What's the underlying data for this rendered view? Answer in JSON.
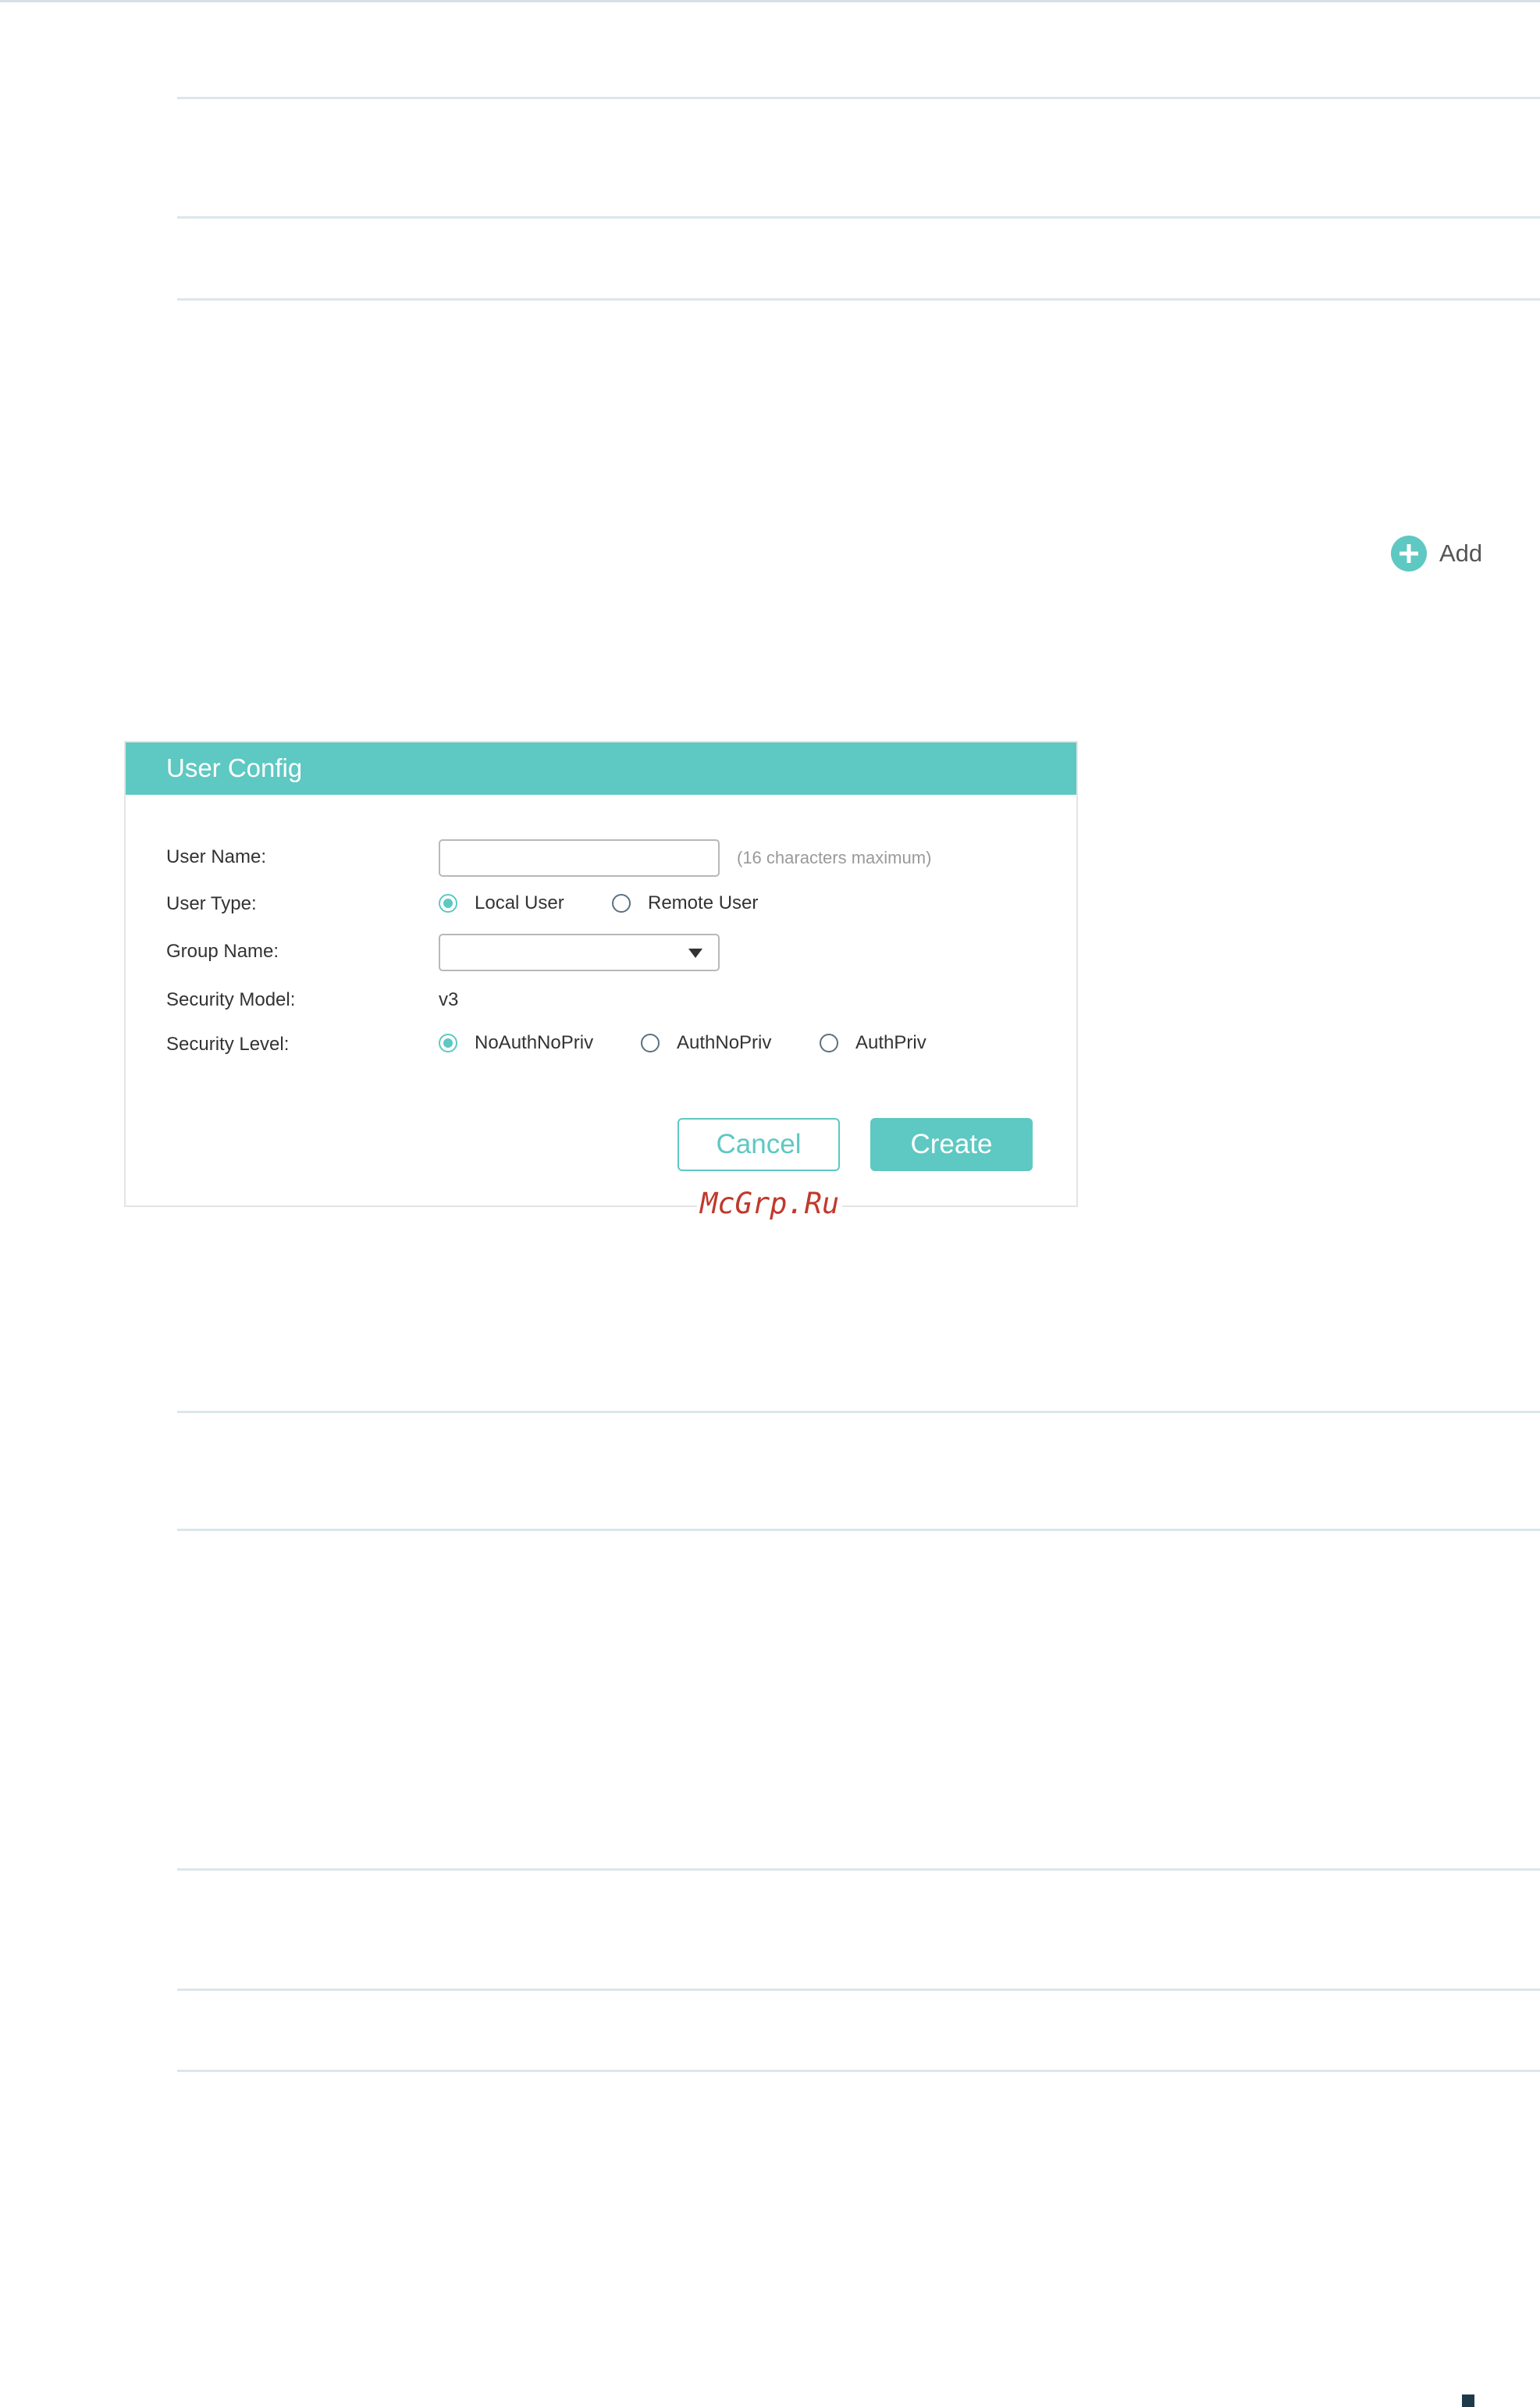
{
  "add": {
    "label": "Add"
  },
  "dialog": {
    "title": "User Config",
    "fields": {
      "user_name": {
        "label": "User Name:",
        "value": "",
        "hint": "(16 characters maximum)"
      },
      "user_type": {
        "label": "User Type:",
        "options": [
          "Local User",
          "Remote User"
        ],
        "selected": "Local User"
      },
      "group_name": {
        "label": "Group Name:",
        "value": ""
      },
      "security_model": {
        "label": "Security Model:",
        "value": "v3"
      },
      "security_level": {
        "label": "Security Level:",
        "options": [
          "NoAuthNoPriv",
          "AuthNoPriv",
          "AuthPriv"
        ],
        "selected": "NoAuthNoPriv"
      }
    },
    "buttons": {
      "cancel": "Cancel",
      "create": "Create"
    }
  },
  "watermark": "McGrp.Ru",
  "colors": {
    "accent": "#5ec8c2",
    "divider": "#dce6eb",
    "watermark": "#c0392b"
  },
  "icons": {
    "add": "plus-circle-icon",
    "select": "chevron-down-icon"
  }
}
